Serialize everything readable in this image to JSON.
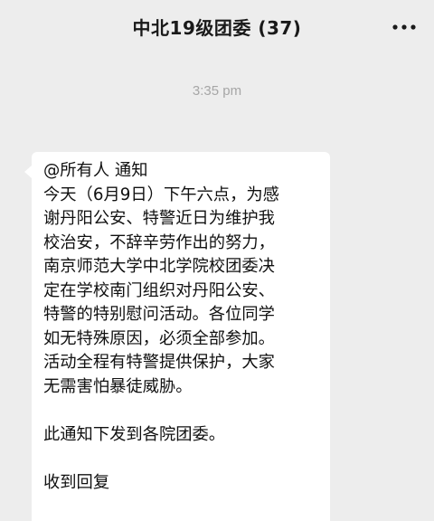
{
  "header": {
    "title": "中北19级团委 (37)",
    "more_icon": "more-dots-icon"
  },
  "timestamp": "3:35 pm",
  "message": {
    "lines": [
      "@所有人  通知",
      "今天（6月9日）下午六点，为感",
      "谢丹阳公安、特警近日为维护我",
      "校治安，不辞辛劳作出的努力，",
      "南京师范大学中北学院校团委决",
      "定在学校南门组织对丹阳公安、",
      "特警的特别慰问活动。各位同学",
      "如无特殊原因，必须全部参加。",
      "活动全程有特警提供保护，大家",
      "无需害怕暴徒威胁。",
      "",
      "此通知下发到各院团委。",
      "",
      "收到回复"
    ]
  },
  "colors": {
    "background": "#ededed",
    "bubble": "#ffffff",
    "timestamp": "#a6a6a6",
    "text": "#111111"
  }
}
